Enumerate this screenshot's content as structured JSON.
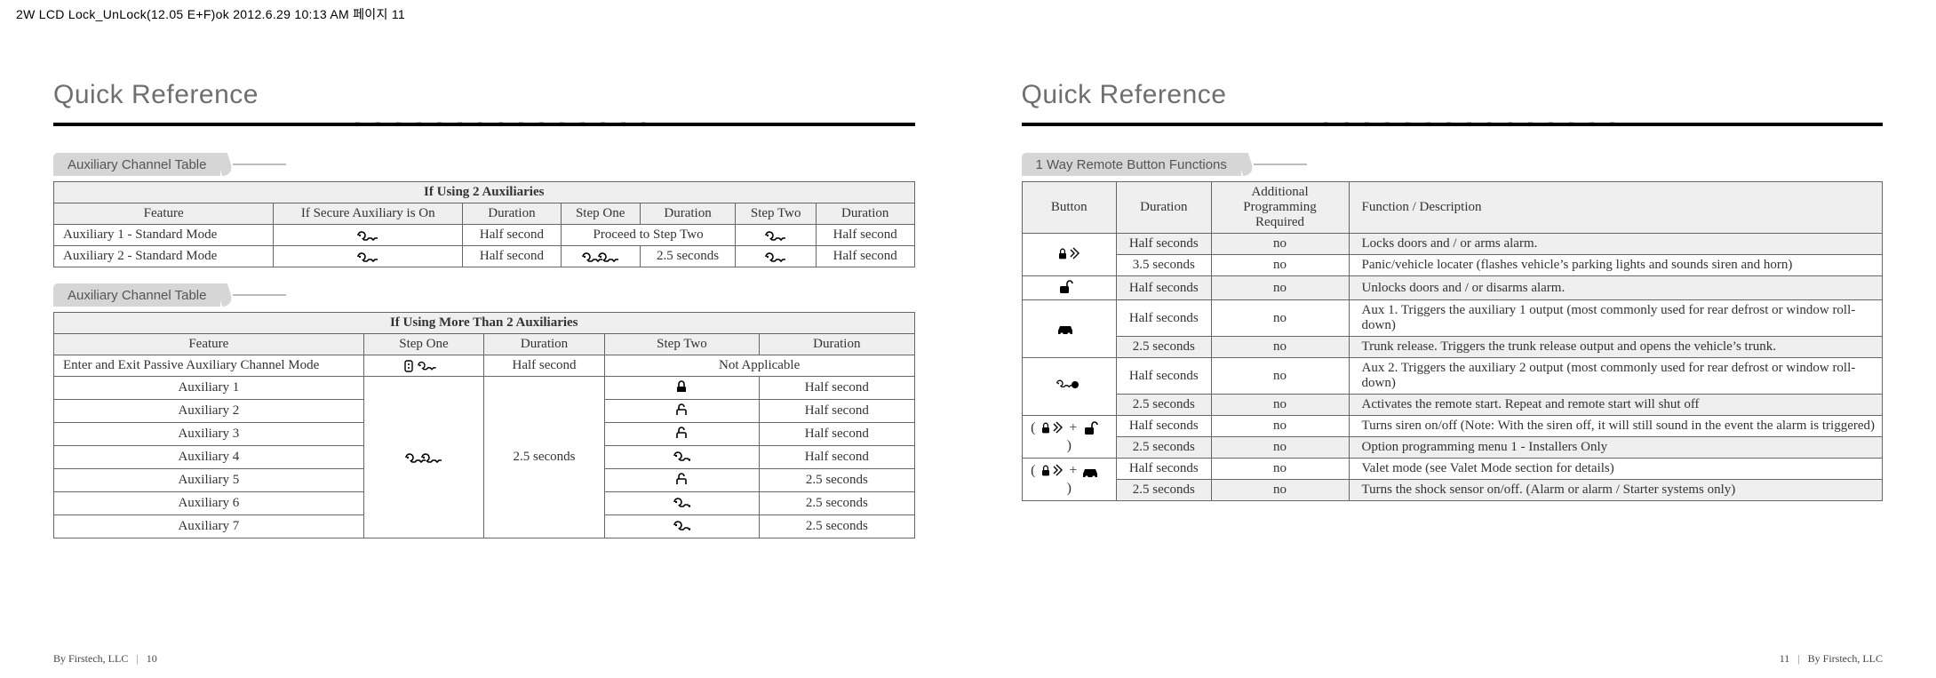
{
  "crop_filename": "2W LCD Lock_UnLock(12.05 E+F)ok  2012.6.29 10:13 AM  페이지 11",
  "left": {
    "page_title": "Quick Reference",
    "tab1": "Auxiliary Channel Table",
    "tab2": "Auxiliary Channel Table",
    "t1_title": "If Using 2 Auxiliaries",
    "t1_headers": {
      "feature": "Feature",
      "secure": "If Secure Auxiliary is On",
      "dur1": "Duration",
      "step1": "Step One",
      "dur2": "Duration",
      "step2": "Step Two",
      "dur3": "Duration"
    },
    "t1_rows": [
      {
        "feature": "Auxiliary 1 - Standard Mode",
        "secure_icon": "key-single",
        "dur1": "Half second",
        "step1_span": "Proceed to Step Two",
        "step2_icon": "key-single",
        "dur3": "Half second"
      },
      {
        "feature": "Auxiliary 2 - Standard Mode",
        "secure_icon": "key-single",
        "dur1": "Half second",
        "step1_icon": "key-double",
        "dur2": "2.5 seconds",
        "step2_icon": "key-single",
        "dur3": "Half second"
      }
    ],
    "t2_title": "If Using More Than 2 Auxiliaries",
    "t2_headers": {
      "feature": "Feature",
      "step1": "Step One",
      "dur1": "Duration",
      "step2": "Step Two",
      "dur2": "Duration"
    },
    "t2_row0": {
      "feature": "Enter and Exit Passive Auxiliary Channel Mode",
      "step1_icon": "remote-key",
      "dur1": "Half second",
      "step2_span": "Not Applicable"
    },
    "t2_rows": [
      {
        "feature": "Auxiliary 1",
        "step2_icon": "lock-closed",
        "dur2": "Half second"
      },
      {
        "feature": "Auxiliary 2",
        "step2_icon": "lock-open",
        "dur2": "Half second"
      },
      {
        "feature": "Auxiliary 3",
        "step2_icon": "lock-open",
        "dur2": "Half second"
      },
      {
        "feature": "Auxiliary 4",
        "step2_icon": "key-single",
        "dur2": "Half second"
      },
      {
        "feature": "Auxiliary 5",
        "step2_icon": "lock-open",
        "dur2": "2.5 seconds"
      },
      {
        "feature": "Auxiliary 6",
        "step2_icon": "key-single",
        "dur2": "2.5 seconds"
      },
      {
        "feature": "Auxiliary 7",
        "step2_icon": "key-single",
        "dur2": "2.5 seconds"
      }
    ],
    "t2_shared": {
      "step1_icon": "key-double",
      "dur1": "2.5 seconds"
    },
    "footer_by": "By Firstech, LLC",
    "footer_page": "10"
  },
  "right": {
    "page_title": "Quick Reference",
    "tab1": "1 Way Remote Button Functions",
    "headers": {
      "button": "Button",
      "duration": "Duration",
      "apr_line1": "Additional Programming",
      "apr_line2": "Required",
      "func": "Function / Description"
    },
    "rows": [
      {
        "button_icon": "lock-sound",
        "btn_rowspan": 2,
        "duration": "Half seconds",
        "apr": "no",
        "desc": "Locks doors and / or arms alarm."
      },
      {
        "duration": "3.5 seconds",
        "apr": "no",
        "desc": "Panic/vehicle locater (flashes vehicle’s parking lights and sounds siren and horn)"
      },
      {
        "button_icon": "unlock",
        "btn_rowspan": 1,
        "duration": "Half seconds",
        "apr": "no",
        "desc": "Unlocks doors and / or disarms alarm."
      },
      {
        "button_icon": "car",
        "btn_rowspan": 2,
        "duration": "Half seconds",
        "apr": "no",
        "desc": "Aux 1. Triggers the auxiliary 1 output (most commonly used for rear defrost or window roll-down)"
      },
      {
        "duration": "2.5 seconds",
        "apr": "no",
        "desc": "Trunk release. Triggers the trunk release output and opens the vehicle’s trunk."
      },
      {
        "button_icon": "key-start",
        "btn_rowspan": 2,
        "duration": "Half seconds",
        "apr": "no",
        "desc": "Aux 2. Triggers the auxiliary 2 output (most commonly used for rear defrost or window roll-down)"
      },
      {
        "duration": "2.5 seconds",
        "apr": "no",
        "desc": "Activates the remote start. Repeat and remote start will shut off"
      },
      {
        "button_combo": "lock-sound+unlock",
        "btn_rowspan": 2,
        "duration": "Half seconds",
        "apr": "no",
        "desc": "Turns siren on/off (Note: With the siren off, it will still sound in the event the alarm is triggered)"
      },
      {
        "duration": "2.5 seconds",
        "apr": "no",
        "desc": "Option programming menu 1 - Installers Only"
      },
      {
        "button_combo": "lock-sound+car",
        "btn_rowspan": 2,
        "duration": "Half seconds",
        "apr": "no",
        "desc": "Valet mode (see Valet Mode section for details)"
      },
      {
        "duration": "2.5 seconds",
        "apr": "no",
        "desc": "Turns the shock sensor on/off.  (Alarm or alarm / Starter systems only)"
      }
    ],
    "footer_by": "By Firstech, LLC",
    "footer_page": "11"
  },
  "icons": {
    "key-single": "key-single-icon",
    "key-double": "key-double-icon",
    "remote-key": "remote-key-icon",
    "lock-closed": "lock-closed-icon",
    "lock-open": "lock-open-icon",
    "lock-sound": "lock-sound-icon",
    "unlock": "unlock-icon",
    "car": "car-icon",
    "key-start": "key-start-icon"
  },
  "chart_data": {
    "type": "table",
    "tables": [
      {
        "title": "If Using 2 Auxiliaries",
        "columns": [
          "Feature",
          "If Secure Auxiliary is On",
          "Duration",
          "Step One",
          "Duration",
          "Step Two",
          "Duration"
        ],
        "rows": [
          [
            "Auxiliary 1 - Standard Mode",
            "[key]",
            "Half second",
            "Proceed to Step Two",
            "",
            "[key]",
            "Half second"
          ],
          [
            "Auxiliary 2 - Standard Mode",
            "[key]",
            "Half second",
            "[key key]",
            "2.5 seconds",
            "[key]",
            "Half second"
          ]
        ]
      },
      {
        "title": "If Using More Than 2 Auxiliaries",
        "columns": [
          "Feature",
          "Step One",
          "Duration",
          "Step Two",
          "Duration"
        ],
        "rows": [
          [
            "Enter and Exit Passive Auxiliary Channel Mode",
            "[remote+key]",
            "Half second",
            "Not Applicable",
            ""
          ],
          [
            "Auxiliary 1",
            "[key key]",
            "2.5 seconds",
            "[lock]",
            "Half second"
          ],
          [
            "Auxiliary 2",
            "[key key]",
            "2.5 seconds",
            "[unlock]",
            "Half second"
          ],
          [
            "Auxiliary 3",
            "[key key]",
            "2.5 seconds",
            "[unlock]",
            "Half second"
          ],
          [
            "Auxiliary 4",
            "[key key]",
            "2.5 seconds",
            "[key]",
            "Half second"
          ],
          [
            "Auxiliary 5",
            "[key key]",
            "2.5 seconds",
            "[unlock]",
            "2.5 seconds"
          ],
          [
            "Auxiliary 6",
            "[key key]",
            "2.5 seconds",
            "[key]",
            "2.5 seconds"
          ],
          [
            "Auxiliary 7",
            "[key key]",
            "2.5 seconds",
            "[key]",
            "2.5 seconds"
          ]
        ]
      },
      {
        "title": "1 Way Remote Button Functions",
        "columns": [
          "Button",
          "Duration",
          "Additional Programming Required",
          "Function / Description"
        ],
        "rows": [
          [
            "Lock/Sound",
            "Half seconds",
            "no",
            "Locks doors and / or arms alarm."
          ],
          [
            "Lock/Sound",
            "3.5 seconds",
            "no",
            "Panic/vehicle locater (flashes vehicle’s parking lights and sounds siren and horn)"
          ],
          [
            "Unlock",
            "Half seconds",
            "no",
            "Unlocks doors and / or disarms alarm."
          ],
          [
            "Car",
            "Half seconds",
            "no",
            "Aux 1. Triggers the auxiliary 1 output (most commonly used for rear defrost or window roll-down)"
          ],
          [
            "Car",
            "2.5 seconds",
            "no",
            "Trunk release. Triggers the trunk release output and opens the vehicle’s trunk."
          ],
          [
            "Key/Start",
            "Half seconds",
            "no",
            "Aux 2. Triggers the auxiliary 2 output (most commonly used for rear defrost or window roll-down)"
          ],
          [
            "Key/Start",
            "2.5 seconds",
            "no",
            "Activates the remote start. Repeat and remote start will shut off"
          ],
          [
            "(Lock/Sound + Unlock)",
            "Half seconds",
            "no",
            "Turns siren on/off (Note: With the siren off, it will still sound in the event the alarm is triggered)"
          ],
          [
            "(Lock/Sound + Unlock)",
            "2.5 seconds",
            "no",
            "Option programming menu 1 - Installers Only"
          ],
          [
            "(Lock/Sound + Car)",
            "Half seconds",
            "no",
            "Valet mode (see Valet Mode section for details)"
          ],
          [
            "(Lock/Sound + Car)",
            "2.5 seconds",
            "no",
            "Turns the shock sensor on/off.  (Alarm or alarm / Starter systems only)"
          ]
        ]
      }
    ]
  }
}
